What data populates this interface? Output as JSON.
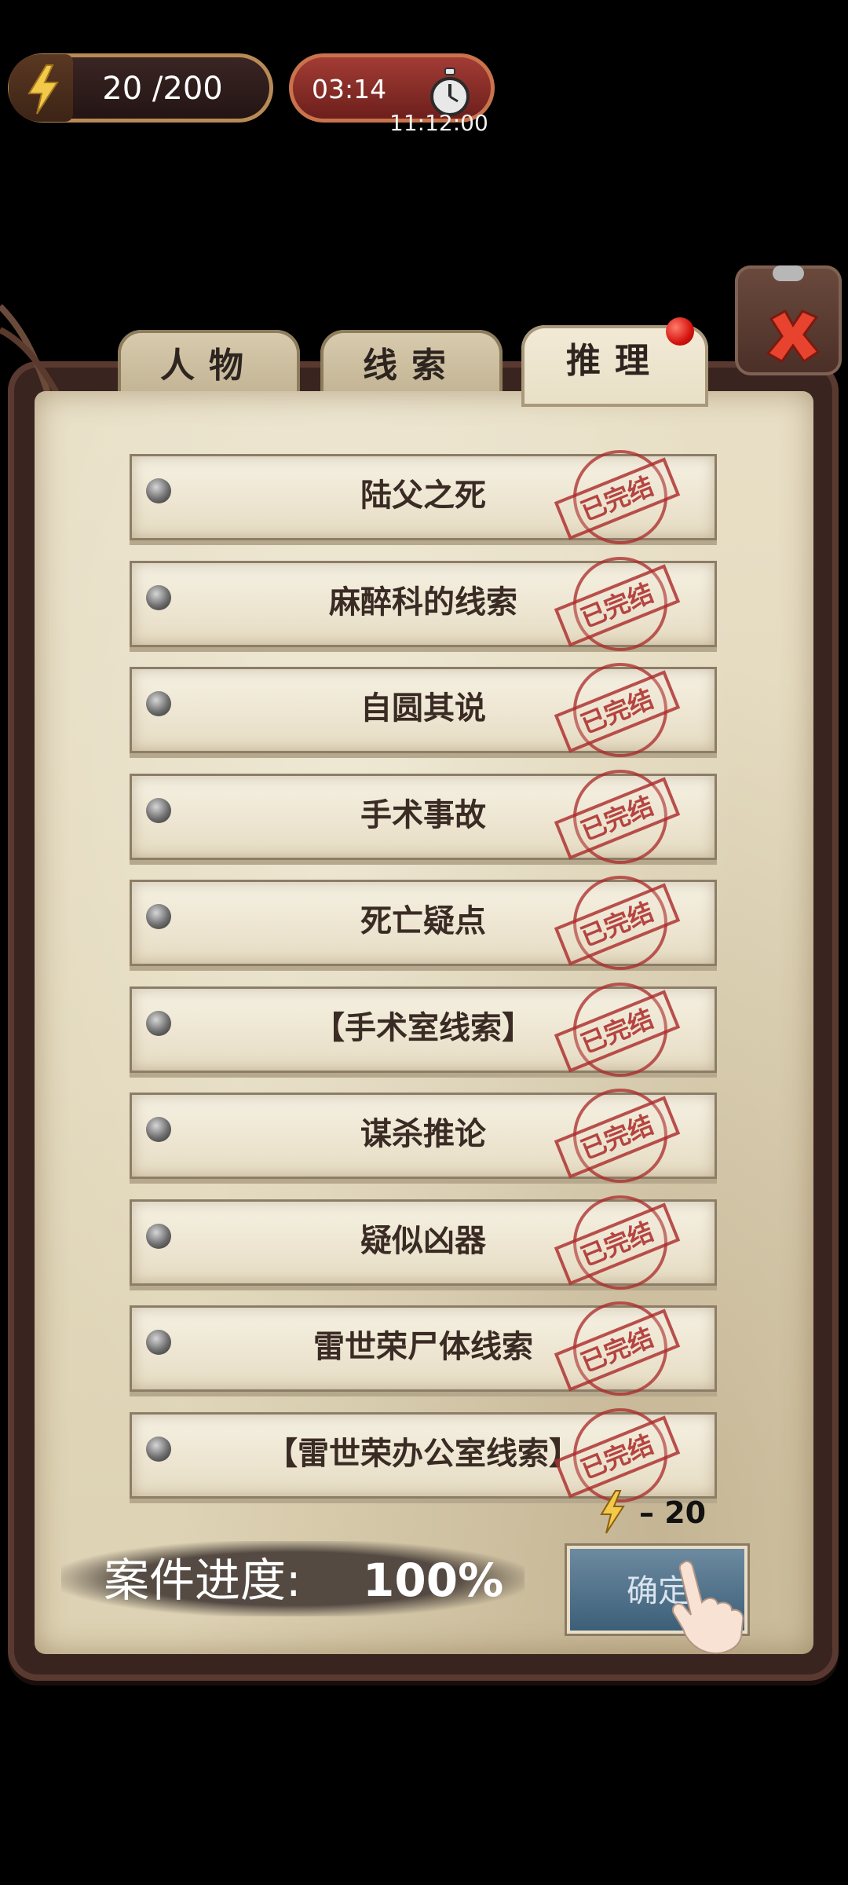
{
  "hud": {
    "energy": "20 /200",
    "timer": "03:14",
    "clock": "11:12:00"
  },
  "tabs": [
    {
      "label": "人物",
      "active": false
    },
    {
      "label": "线索",
      "active": false
    },
    {
      "label": "推理",
      "active": true
    }
  ],
  "items": [
    {
      "label": "陆父之死",
      "stamp": "已完结"
    },
    {
      "label": "麻醉科的线索",
      "stamp": "已完结"
    },
    {
      "label": "自圆其说",
      "stamp": "已完结"
    },
    {
      "label": "手术事故",
      "stamp": "已完结"
    },
    {
      "label": "死亡疑点",
      "stamp": "已完结"
    },
    {
      "label": "【手术室线索】",
      "stamp": "已完结"
    },
    {
      "label": "谋杀推论",
      "stamp": "已完结"
    },
    {
      "label": "疑似凶器",
      "stamp": "已完结"
    },
    {
      "label": "雷世荣尸体线索",
      "stamp": "已完结"
    },
    {
      "label": "【雷世荣办公室线索】",
      "stamp": "已完结"
    }
  ],
  "cost": "– 20",
  "progress": {
    "label": "案件进度:",
    "value": "100%"
  },
  "confirm_label": "确定",
  "icons": [
    "lightning-icon",
    "stopwatch-icon",
    "close-icon",
    "pointing-hand-icon"
  ],
  "colors": {
    "stamp_red": "#aa2828",
    "timer_red": "#a23c34",
    "confirm_blue": "#4f7089"
  }
}
